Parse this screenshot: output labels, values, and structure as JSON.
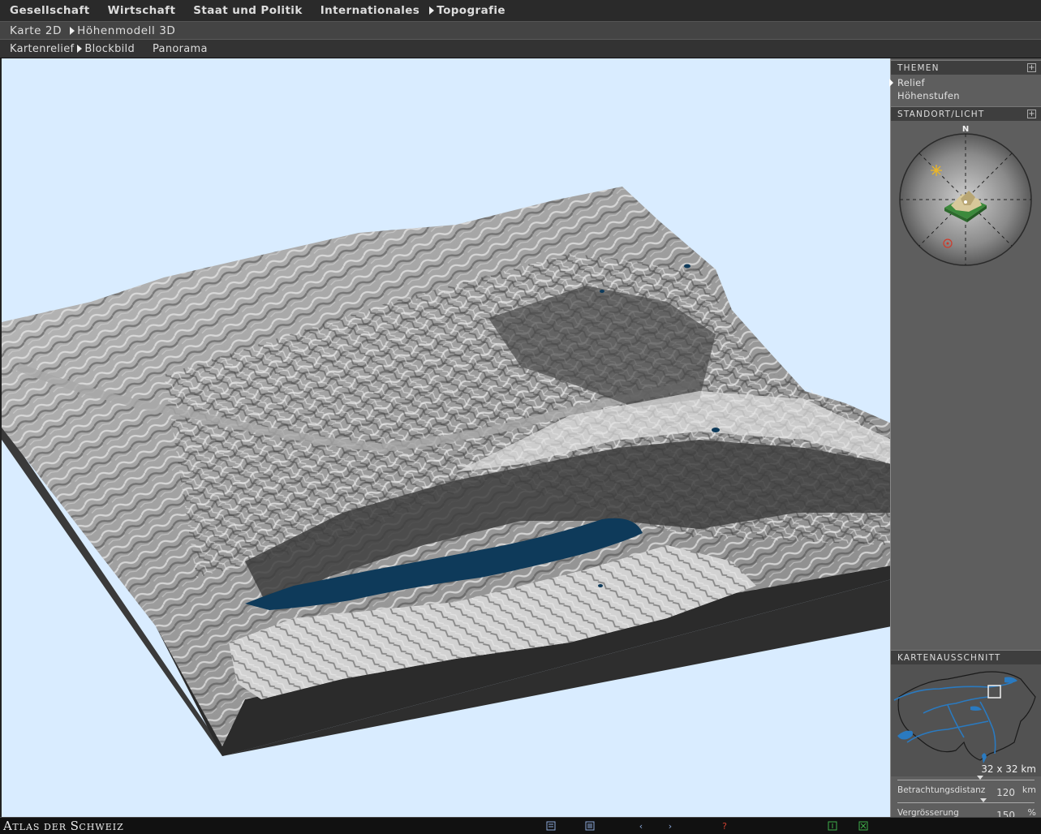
{
  "nav": {
    "main": [
      "Gesellschaft",
      "Wirtschaft",
      "Staat und Politik",
      "Internationales",
      "Topografie"
    ],
    "main_selected": "Topografie",
    "sub": [
      "Karte 2D",
      "Höhenmodell 3D"
    ],
    "sub_selected": "Höhenmodell 3D",
    "view": [
      "Kartenrelief",
      "Blockbild",
      "Panorama"
    ],
    "view_selected": "Blockbild"
  },
  "sidebar": {
    "themes_title": "THEMEN",
    "themes": [
      "Relief",
      "Höhenstufen"
    ],
    "themes_selected": "Relief",
    "location_title": "STANDORT/LICHT",
    "compass_north": "N",
    "map_section_title": "KARTENAUSSCHNITT",
    "map_scale": "32 x 32 km",
    "distance_label": "Betrachtungsdistanz",
    "distance_value": "120",
    "distance_unit": "km",
    "zoom_label": "Vergrösserung",
    "zoom_value": "150",
    "zoom_unit": "%"
  },
  "footer": {
    "brand_first": "A",
    "brand_rest1": "TLAS DER ",
    "brand_second": "S",
    "brand_rest2": "CHWEIZ"
  },
  "colors": {
    "sky": "#d9ecff",
    "lake": "#0e3a5a",
    "terrain_light": "#c8c8c8",
    "terrain_dark": "#2f2f2f",
    "sun": "#e8b52a",
    "viewpoint": "#d03a2a"
  },
  "icons": [
    "legend-icon",
    "list-icon",
    "back-icon",
    "forward-icon",
    "help-icon",
    "page-icon",
    "close-icon"
  ]
}
